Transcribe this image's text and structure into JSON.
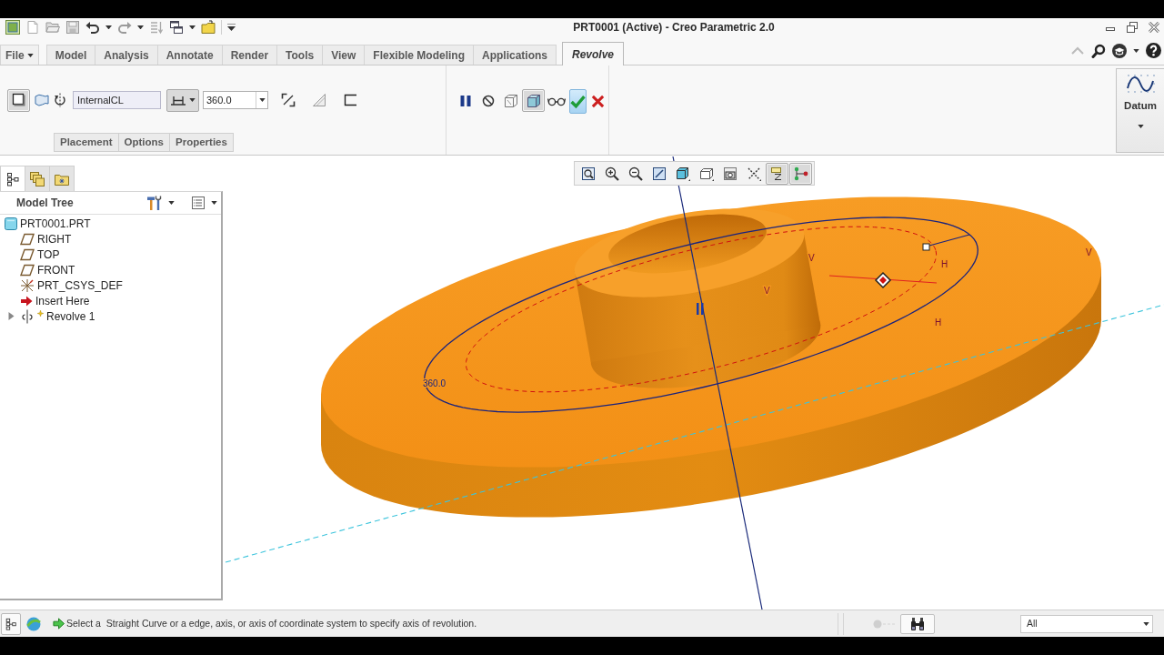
{
  "title_bar": {
    "title": "PRT0001 (Active) - Creo Parametric 2.0"
  },
  "ribbon_tabs": [
    {
      "label": "File",
      "kind": "menu",
      "selected": false
    },
    {
      "label": "Model",
      "kind": "tab",
      "selected": false
    },
    {
      "label": "Analysis",
      "kind": "tab",
      "selected": false
    },
    {
      "label": "Annotate",
      "kind": "tab",
      "selected": false
    },
    {
      "label": "Render",
      "kind": "tab",
      "selected": false
    },
    {
      "label": "Tools",
      "kind": "tab",
      "selected": false
    },
    {
      "label": "View",
      "kind": "tab",
      "selected": false
    },
    {
      "label": "Flexible Modeling",
      "kind": "tab",
      "selected": false
    },
    {
      "label": "Applications",
      "kind": "tab",
      "selected": false
    },
    {
      "label": "Revolve",
      "kind": "tab",
      "selected": true
    }
  ],
  "dashboard": {
    "feature_types": [
      {
        "kind": "solid",
        "selected": true
      },
      {
        "kind": "surface",
        "selected": false
      }
    ],
    "axis_reference": {
      "value": "InternalCL"
    },
    "angle_option": {
      "selected": true
    },
    "angle": {
      "value": "360.0"
    },
    "preview_tools": [
      {
        "kind": "pause",
        "on": false
      },
      {
        "kind": "no_preview",
        "on": false
      },
      {
        "kind": "geometry_preview",
        "on": false
      },
      {
        "kind": "verify",
        "on": true
      },
      {
        "kind": "glasses",
        "on": false
      }
    ],
    "panels": [
      {
        "label": "Placement",
        "selected": false
      },
      {
        "label": "Options",
        "selected": false
      },
      {
        "label": "Properties",
        "selected": false
      }
    ]
  },
  "datum_group": {
    "label": "Datum"
  },
  "navigator": {
    "tabs": [
      {
        "kind": "model_tree",
        "selected": true
      },
      {
        "kind": "layers",
        "selected": false
      },
      {
        "kind": "folder_browser",
        "selected": false
      }
    ],
    "title": "Model Tree",
    "tree": [
      {
        "label": "PRT0001.PRT",
        "kind": "part",
        "children": [
          {
            "label": "RIGHT",
            "kind": "plane",
            "in_edit": false
          },
          {
            "label": "TOP",
            "kind": "plane",
            "in_edit": false
          },
          {
            "label": "FRONT",
            "kind": "plane",
            "in_edit": false
          },
          {
            "label": "PRT_CSYS_DEF",
            "kind": "csys",
            "in_edit": false
          },
          {
            "label": "Insert Here",
            "kind": "insert",
            "in_edit": false
          },
          {
            "label": "Revolve 1",
            "kind": "revolve",
            "in_edit": true,
            "expanded": false
          }
        ]
      }
    ]
  },
  "graphics_toolbar": [
    {
      "kind": "refit",
      "on": false
    },
    {
      "kind": "zoom_in",
      "on": false
    },
    {
      "kind": "zoom_out",
      "on": false
    },
    {
      "kind": "repaint",
      "on": false
    },
    {
      "kind": "display_style",
      "on": false
    },
    {
      "kind": "saved_views",
      "on": false
    },
    {
      "kind": "view_manager",
      "on": false
    },
    {
      "kind": "datum_display",
      "on": false
    },
    {
      "kind": "annotation_display",
      "on": true
    },
    {
      "kind": "spin_center",
      "on": true
    }
  ],
  "viewport": {
    "labels": [
      {
        "kind": "dimension",
        "text": "360.0"
      },
      {
        "kind": "constraint",
        "text": "V"
      },
      {
        "kind": "constraint",
        "text": "V"
      },
      {
        "kind": "constraint",
        "text": "V"
      },
      {
        "kind": "constraint",
        "text": "H"
      },
      {
        "kind": "constraint",
        "text": "H"
      }
    ]
  },
  "status_bar": {
    "message": "Select a  Straight Curve or a edge, axis, or axis of coordinate system to specify axis of revolution.",
    "filter": {
      "value": "All"
    }
  }
}
